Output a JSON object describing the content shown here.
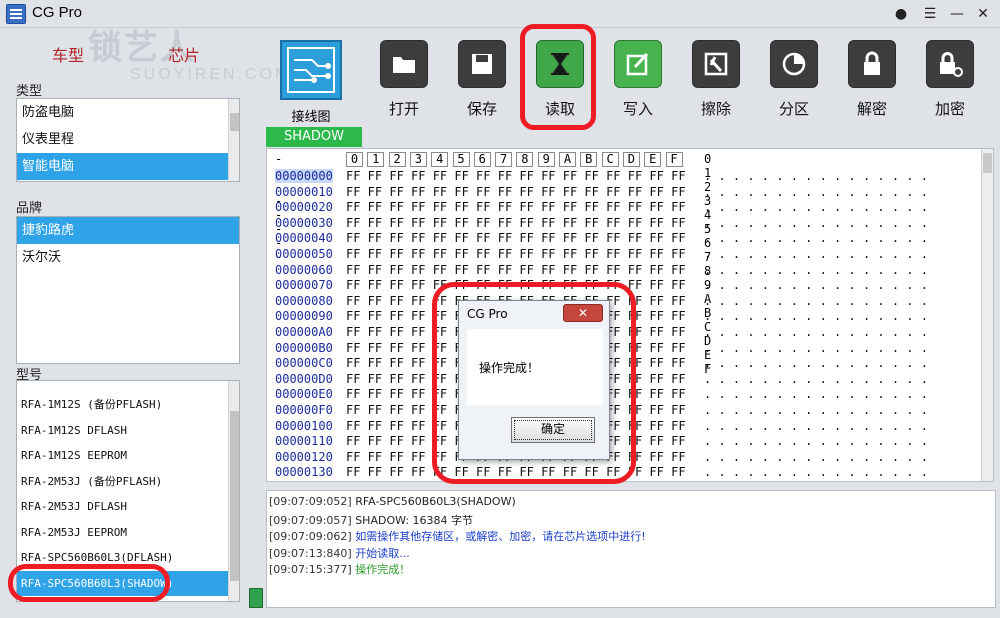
{
  "window": {
    "title": "CG Pro"
  },
  "watermark": {
    "text": "锁艺人",
    "sub": "SUOYIREN.COM"
  },
  "left": {
    "tabs": [
      "车型",
      "芯片"
    ],
    "type_label": "类型",
    "type_items": [
      "防盗电脑",
      "仪表里程",
      "智能电脑"
    ],
    "type_selected": 2,
    "brand_label": "品牌",
    "brand_items": [
      "捷豹路虎",
      "沃尔沃"
    ],
    "brand_selected": 0,
    "model_label": "型号",
    "model_items": [
      "RFA-1M12S (备份PFLASH)",
      "RFA-1M12S DFLASH",
      "RFA-1M12S EEPROM",
      "RFA-2M53J (备份PFLASH)",
      "RFA-2M53J DFLASH",
      "RFA-2M53J EEPROM",
      "RFA-SPC560B60L3(DFLASH)",
      "RFA-SPC560B60L3(SHADOW)"
    ],
    "model_selected": 7
  },
  "toolbar": {
    "wiring_label": "接线图",
    "buttons": [
      {
        "label": "打开",
        "icon": "folder-icon"
      },
      {
        "label": "保存",
        "icon": "save-icon"
      },
      {
        "label": "读取",
        "icon": "hourglass-icon"
      },
      {
        "label": "写入",
        "icon": "edit-icon"
      },
      {
        "label": "擦除",
        "icon": "eraser-icon"
      },
      {
        "label": "分区",
        "icon": "pie-icon"
      },
      {
        "label": "解密",
        "icon": "unlock-icon"
      },
      {
        "label": "加密",
        "icon": "lock-gear-icon"
      }
    ]
  },
  "hex": {
    "mode_badge": "SHADOW",
    "header_dashes": "--------",
    "columns": [
      "0",
      "1",
      "2",
      "3",
      "4",
      "5",
      "6",
      "7",
      "8",
      "9",
      "A",
      "B",
      "C",
      "D",
      "E",
      "F"
    ],
    "ascii_header": "0 1 2 3 4 5 6 7 8 9 A B C D E F",
    "rows": [
      "00000000",
      "00000010",
      "00000020",
      "00000030",
      "00000040",
      "00000050",
      "00000060",
      "00000070",
      "00000080",
      "00000090",
      "000000A0",
      "000000B0",
      "000000C0",
      "000000D0",
      "000000E0",
      "000000F0",
      "00000100",
      "00000110",
      "00000120",
      "00000130"
    ],
    "byte_value": "FF",
    "ascii_char": ".",
    "selected_row": 0
  },
  "log": [
    {
      "time": "[09:07:09:052]",
      "text": "RFA-SPC560B60L3(SHADOW)",
      "color": "#222222"
    },
    {
      "time": "[09:07:09:057]",
      "text": "SHADOW:  16384  字节",
      "color": "#222222"
    },
    {
      "time": "[09:07:09:062]",
      "text": "如需操作其他存储区，或解密、加密，请在芯片选项中进行!",
      "color": "#1a3fc9"
    },
    {
      "time": "[09:07:13:840]",
      "text": "开始读取...",
      "color": "#1a3fc9"
    },
    {
      "time": "[09:07:15:377]",
      "text": "操作完成！",
      "color": "#2a9d2a"
    }
  ],
  "dialog": {
    "title": "CG Pro",
    "close": "✕",
    "message": "操作完成！",
    "ok": "确定"
  }
}
